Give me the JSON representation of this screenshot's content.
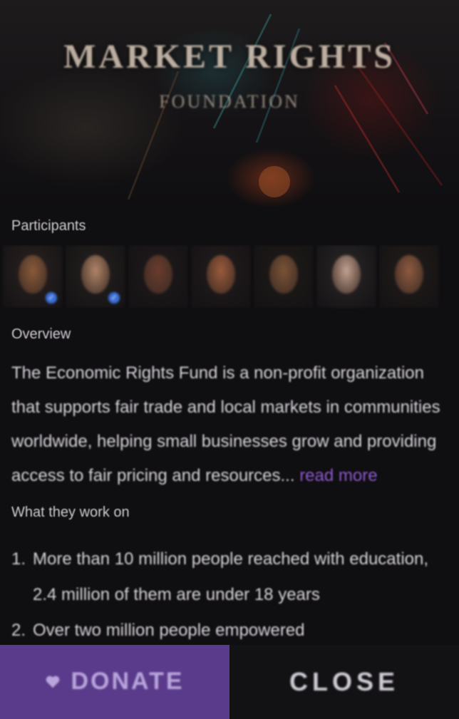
{
  "hero": {
    "title": "MARKET RIGHTS",
    "subtitle": "FOUNDATION"
  },
  "participants": {
    "heading": "Participants",
    "people": [
      {
        "skin": "#8a5a3a",
        "bg": "#2a2220",
        "verified": true
      },
      {
        "skin": "#b08468",
        "bg": "#24201e",
        "verified": true
      },
      {
        "skin": "#6a3c2e",
        "bg": "#1f1a1b",
        "verified": false
      },
      {
        "skin": "#9a5a3c",
        "bg": "#221c1c",
        "verified": false
      },
      {
        "skin": "#7a5236",
        "bg": "#1e1a18",
        "verified": false
      },
      {
        "skin": "#c2a090",
        "bg": "#2a2628",
        "verified": false
      },
      {
        "skin": "#8e5a40",
        "bg": "#221c1a",
        "verified": false
      }
    ]
  },
  "overview": {
    "heading": "Overview",
    "text": "The Economic Rights Fund is a non-profit organization that supports fair trade and local markets in communities worldwide, helping small businesses grow and providing access to fair pricing and resources...",
    "read_more": "read more"
  },
  "what_we_do": {
    "heading": "What they work on",
    "items": [
      {
        "num": "1.",
        "text": "More than 10 million people reached with education, 2.4 million of them are under 18 years"
      },
      {
        "num": "2.",
        "text": "Over two million people empowered"
      }
    ]
  },
  "actions": {
    "donate_label": "DONATE",
    "close_label": "CLOSE"
  }
}
